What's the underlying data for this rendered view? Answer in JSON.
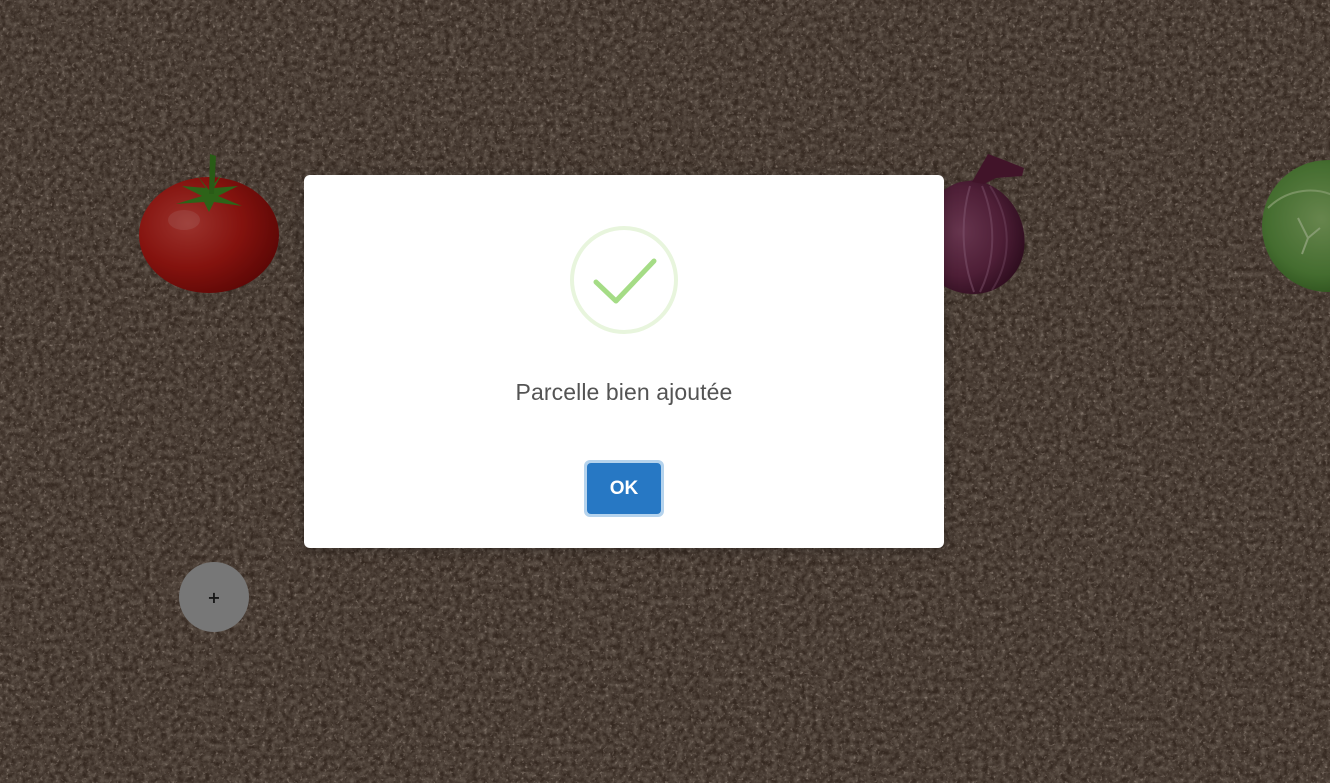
{
  "dialog": {
    "title": "Parcelle bien ajoutée",
    "confirm_label": "OK",
    "icon": "success-check-icon"
  },
  "fab": {
    "label": "+"
  },
  "garden": {
    "plots": [
      {
        "vegetable": "tomato-icon"
      },
      {
        "vegetable": "red-onion-icon"
      },
      {
        "vegetable": "cabbage-icon"
      }
    ]
  },
  "colors": {
    "soil": "#3b2d24",
    "accent": "#2778c4",
    "success": "#a5dc86",
    "success_ring": "#e8f5dd",
    "fab": "#a5a5a5"
  }
}
